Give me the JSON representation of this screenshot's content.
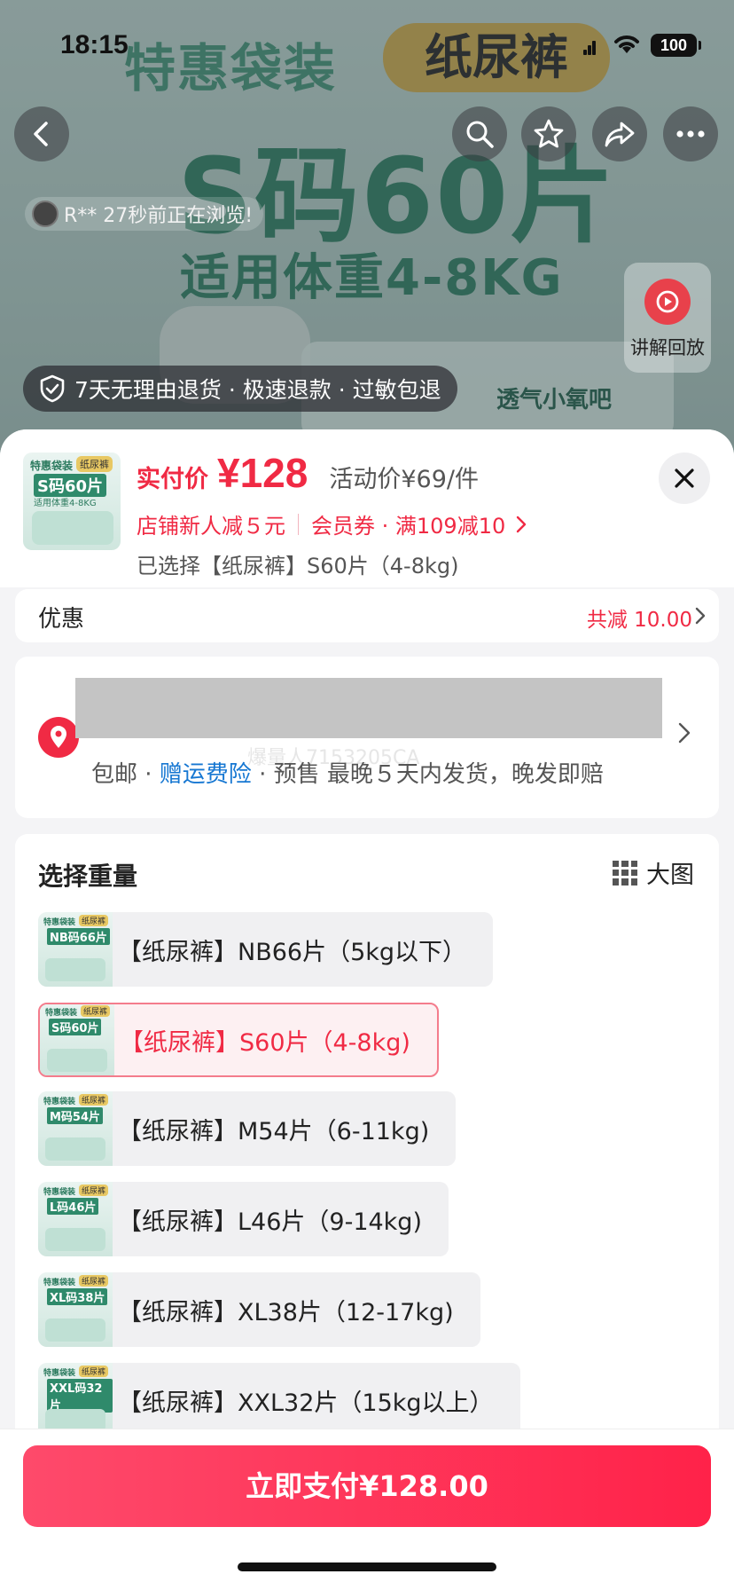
{
  "status_bar": {
    "time": "18:15",
    "battery": "100"
  },
  "hero": {
    "title": "特惠袋装",
    "tag": "纸尿裤",
    "size_text": "S码60片",
    "weight_text": "适用体重4-8KG",
    "pack_label": "透气小氧吧"
  },
  "viewer_notice": "R** 27秒前正在浏览!",
  "replay_label": "讲解回放",
  "guarantee": "7天无理由退货 · 极速退款 · 过敏包退",
  "product": {
    "thumb": {
      "brand": "特惠袋装",
      "tag": "纸尿裤",
      "size": "S码60片",
      "weight": "适用体重4-8KG"
    },
    "price_label": "实付价",
    "price": "¥128",
    "activity_price": "活动价¥69/件",
    "promo_new": "店铺新人减５元",
    "promo_member": "会员券 · 满109减10",
    "selected": "已选择【纸尿裤】S60片（4-8kg)"
  },
  "discount": {
    "label": "优惠",
    "value": "共减 10.00"
  },
  "shipping": {
    "watermark": "爆量人7153205CA",
    "free": "包邮 · ",
    "insurance": "赠运费险",
    "rest": " · 预售 最晚５天内发货，晚发即赔"
  },
  "weight_section": {
    "title": "选择重量",
    "big_view": "大图",
    "options": [
      {
        "label": "【纸尿裤】NB66片（5kg以下）",
        "thumb": "NB码66片",
        "selected": false
      },
      {
        "label": "【纸尿裤】S60片（4-8kg)",
        "thumb": "S码60片",
        "selected": true
      },
      {
        "label": "【纸尿裤】M54片（6-11kg)",
        "thumb": "M码54片",
        "selected": false
      },
      {
        "label": "【纸尿裤】L46片（9-14kg)",
        "thumb": "L码46片",
        "selected": false
      },
      {
        "label": "【纸尿裤】XL38片（12-17kg)",
        "thumb": "XL码38片",
        "selected": false
      },
      {
        "label": "【纸尿裤】XXL32片（15kg以上）",
        "thumb": "XXL码32片",
        "selected": false
      }
    ],
    "thumb_brand": "特惠袋装",
    "thumb_tag": "纸尿裤"
  },
  "pay_button": "立即支付¥128.00",
  "colors": {
    "accent": "#f02a44",
    "link": "#1677d2",
    "pay_start": "#fe4a6b",
    "pay_end": "#ff2249"
  }
}
